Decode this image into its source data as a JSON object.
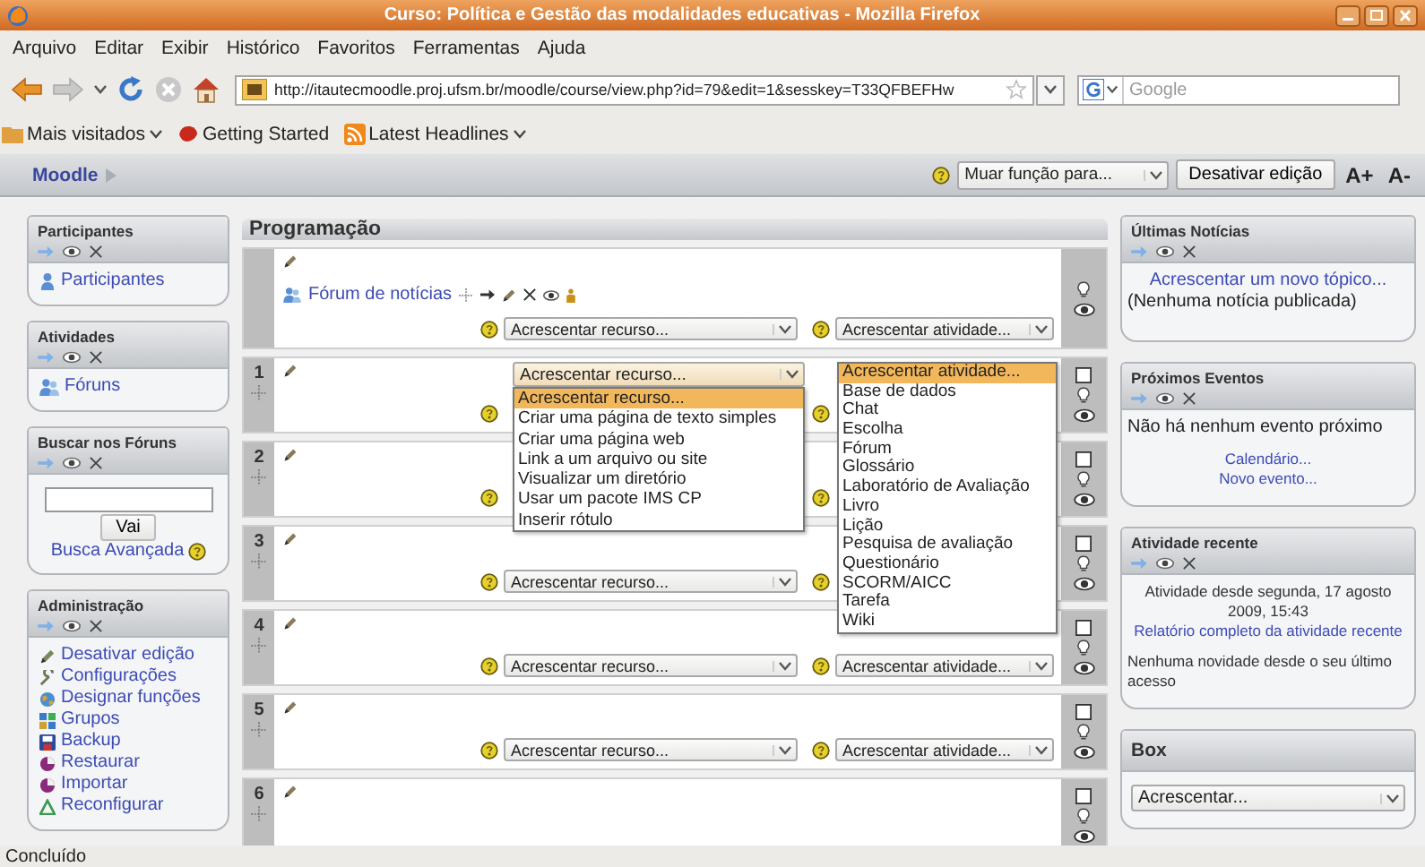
{
  "window": {
    "title": "Curso: Política e Gestão das modalidades educativas - Mozilla Firefox"
  },
  "menu": [
    "Arquivo",
    "Editar",
    "Exibir",
    "Histórico",
    "Favoritos",
    "Ferramentas",
    "Ajuda"
  ],
  "address_bar": {
    "url": "http://itautecmoodle.proj.ufsm.br/moodle/course/view.php?id=79&edit=1&sesskey=T33QFBEFHw"
  },
  "search": {
    "placeholder": "Google"
  },
  "bookmarks": [
    {
      "label": "Mais visitados",
      "kind": "folder"
    },
    {
      "label": "Getting Started",
      "kind": "page"
    },
    {
      "label": "Latest Headlines",
      "kind": "feed"
    }
  ],
  "moodle_bar": {
    "home": "Moodle",
    "role_select": "Muar função para...",
    "edit_button": "Desativar edição",
    "font_buttons": [
      "A+",
      "A-"
    ]
  },
  "left_blocks": [
    {
      "title": "Participantes",
      "controls": true,
      "kind": "links",
      "links": [
        "Participantes"
      ]
    },
    {
      "title": "Atividades",
      "controls": true,
      "kind": "links",
      "links": [
        "Fóruns"
      ]
    },
    {
      "title": "Buscar nos Fóruns",
      "controls": true,
      "kind": "search",
      "button": "Vai",
      "link": "Busca Avançada"
    },
    {
      "title": "Administração",
      "controls": true,
      "kind": "links",
      "links": [
        "Desativar edição",
        "Configurações",
        "Designar funções",
        "Grupos",
        "Backup",
        "Restaurar",
        "Importar",
        "Reconfigurar"
      ]
    }
  ],
  "course": {
    "title": "Programação",
    "sections": [
      {
        "kind": "general",
        "activity": "Fórum de notícias",
        "add_row": true,
        "resource_select": "Acrescentar recurso...",
        "activity_select": "Acrescentar atividade..."
      },
      {
        "kind": "topic",
        "number": "1",
        "highlighted": false,
        "add_row": true
      },
      {
        "kind": "topic",
        "number": "2",
        "highlighted": false,
        "add_row": true
      },
      {
        "kind": "topic",
        "number": "3",
        "highlighted": false,
        "add_row": true,
        "resource_select": "Acrescentar recurso..."
      },
      {
        "kind": "topic",
        "number": "4",
        "highlighted": false,
        "add_row": true,
        "resource_select": "Acrescentar recurso...",
        "activity_select": "Acrescentar atividade..."
      },
      {
        "kind": "topic",
        "number": "5",
        "highlighted": false,
        "add_row": true,
        "resource_select": "Acrescentar recurso...",
        "activity_select": "Acrescentar atividade..."
      },
      {
        "kind": "topic",
        "number": "6",
        "highlighted": false,
        "add_row": false
      }
    ]
  },
  "resource_menu": {
    "value": "Acrescentar recurso...",
    "options": [
      {
        "label": "Acrescentar recurso...",
        "selected": true
      },
      {
        "label": "Criar uma página de texto simples",
        "selected": false
      },
      {
        "label": "Criar uma página web",
        "selected": false
      },
      {
        "label": "Link a um arquivo ou site",
        "selected": false
      },
      {
        "label": "Visualizar um diretório",
        "selected": false
      },
      {
        "label": "Usar um pacote IMS CP",
        "selected": false
      },
      {
        "label": "Inserir rótulo",
        "selected": false
      }
    ]
  },
  "activity_menu": {
    "options": [
      {
        "label": "Acrescentar atividade...",
        "selected": true
      },
      {
        "label": "Base de dados",
        "selected": false
      },
      {
        "label": "Chat",
        "selected": false
      },
      {
        "label": "Escolha",
        "selected": false
      },
      {
        "label": "Fórum",
        "selected": false
      },
      {
        "label": "Glossário",
        "selected": false
      },
      {
        "label": "Laboratório de Avaliação",
        "selected": false
      },
      {
        "label": "Livro",
        "selected": false
      },
      {
        "label": "Lição",
        "selected": false
      },
      {
        "label": "Pesquisa de avaliação",
        "selected": false
      },
      {
        "label": "Questionário",
        "selected": false
      },
      {
        "label": "SCORM/AICC",
        "selected": false
      },
      {
        "label": "Tarefa",
        "selected": false
      },
      {
        "label": "Wiki",
        "selected": false
      }
    ]
  },
  "right_blocks": [
    {
      "title": "Últimas Notícias",
      "controls": true,
      "kind": "items",
      "items": [
        {
          "kind": "link",
          "text": "Acrescentar um novo tópico..."
        },
        {
          "kind": "text",
          "text": "(Nenhuma notícia publicada)"
        }
      ]
    },
    {
      "title": "Próximos Eventos",
      "controls": true,
      "kind": "items",
      "items": [
        {
          "kind": "text",
          "text": "Não há nenhum evento próximo"
        },
        {
          "kind": "small_link",
          "text": "Calendário..."
        },
        {
          "kind": "small_link",
          "text": "Novo evento..."
        }
      ]
    },
    {
      "title": "Atividade recente",
      "controls": true,
      "kind": "items",
      "items": [
        {
          "kind": "note",
          "text": "Atividade desde segunda, 17 agosto 2009, 15:43"
        },
        {
          "kind": "small_link",
          "text": "Relatório completo da atividade recente"
        },
        {
          "kind": "small_text",
          "text": "Nenhuma novidade desde o seu último acesso"
        }
      ]
    },
    {
      "title": "Box",
      "controls": false,
      "kind": "select",
      "select": "Acrescentar..."
    }
  ],
  "status_bar": "Concluído"
}
